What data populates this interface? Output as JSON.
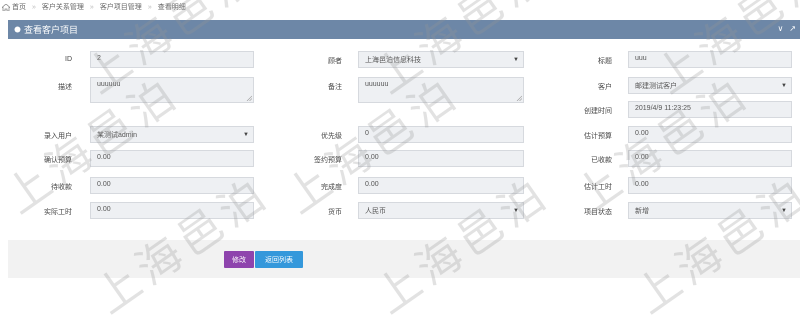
{
  "breadcrumb": [
    "首页",
    "客户关系管理",
    "客户项目管理",
    "查看明细"
  ],
  "panel": {
    "title": "查看客户项目",
    "tool_min": "∨",
    "tool_close": "↗"
  },
  "fields": {
    "id": {
      "label": "ID",
      "value": "2"
    },
    "owner": {
      "label": "顾者",
      "value": "上海邑泊信息科技"
    },
    "title": {
      "label": "标题",
      "value": "uuu"
    },
    "desc": {
      "label": "描述",
      "value": "uuuuuu"
    },
    "remark": {
      "label": "备注",
      "value": "uuuuuu"
    },
    "customer": {
      "label": "客户",
      "value": "邮建测试客户"
    },
    "created": {
      "label": "创建时间",
      "value": "2019/4/9 11:23:25"
    },
    "entry_user": {
      "label": "录入用户",
      "value": "某测试admin"
    },
    "priority": {
      "label": "优先级",
      "value": "0"
    },
    "budget_est": {
      "label": "估计预算",
      "value": "0.00"
    },
    "budget_confirm": {
      "label": "确认预算",
      "value": "0.00"
    },
    "budget_signed": {
      "label": "签约预算",
      "value": "0.00"
    },
    "received": {
      "label": "已收款",
      "value": "0.00"
    },
    "pending": {
      "label": "待收款",
      "value": "0.00"
    },
    "completion": {
      "label": "完成度",
      "value": "0.00"
    },
    "hours_est": {
      "label": "估计工时",
      "value": "0.00"
    },
    "hours_actual": {
      "label": "实际工时",
      "value": "0.00"
    },
    "currency": {
      "label": "货币",
      "value": "人民币"
    },
    "status": {
      "label": "项目状态",
      "value": "新增"
    }
  },
  "buttons": {
    "edit": "修改",
    "back": "返回列表"
  },
  "watermark": "上海邑泊",
  "colors": {
    "header": "#6d87a7",
    "edit": "#8e44ad",
    "back": "#3498db"
  }
}
